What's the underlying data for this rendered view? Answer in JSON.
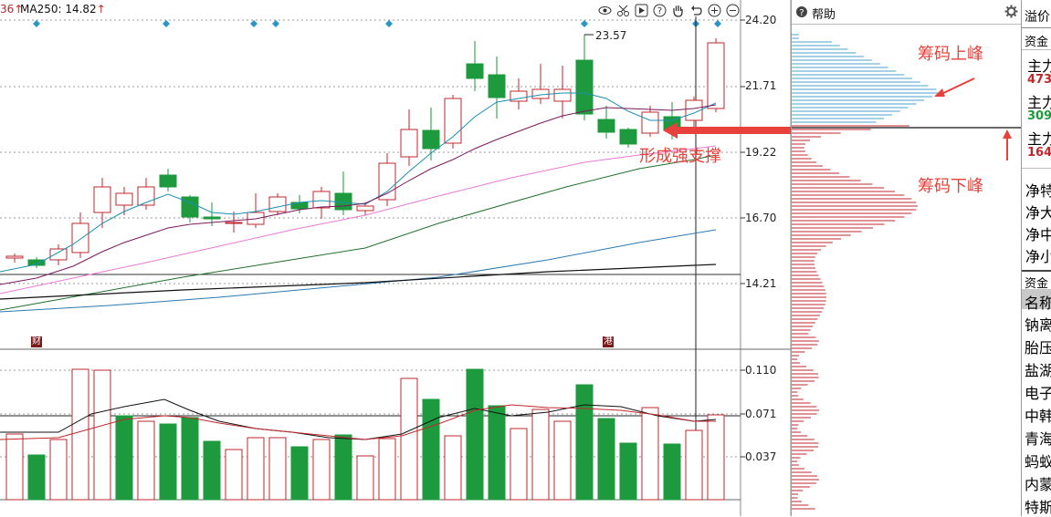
{
  "toolbar": {
    "ma_prefix": "36",
    "ma250_label": "MA250: 14.82",
    "up_arrow": "↑",
    "icons": [
      "eye-icon",
      "scissors-icon",
      "play-icon",
      "help-icon",
      "hand-icon",
      "undo-icon",
      "zoom-in-icon",
      "zoom-out-icon"
    ]
  },
  "price_axis": {
    "ticks": [
      "24.20",
      "21.71",
      "19.22",
      "16.70",
      "14.21"
    ],
    "high_marker": "23.57"
  },
  "volume_axis": {
    "ticks": [
      "0.110",
      "0.071",
      "0.037"
    ]
  },
  "event_tags": [
    "财",
    "港"
  ],
  "annotations": {
    "strong_support": "形成强支撑",
    "chip_up_peak": "筹码上峰",
    "chip_down_peak": "筹码下峰"
  },
  "colors": {
    "up": "#c0272d",
    "down": "#1e9a3e",
    "annotation": "#e8403a",
    "ma_short": "#1a8fb0",
    "ma_mid": "#7b1a5e",
    "ma_pink": "#e87ad6",
    "ma_green": "#1f6f2a",
    "ma_blue": "#2a7ab0",
    "ma_black": "#111111",
    "chip_upper": "#4aa3c8",
    "chip_lower": "#c0272d"
  },
  "help_panel": {
    "title": "帮助"
  },
  "right_panel": {
    "top_label": "溢价",
    "fund_header": "资金",
    "rows": [
      {
        "text": "主力",
        "color": "#000000"
      },
      {
        "text": "473",
        "color": "#c0272d"
      },
      {
        "text": "主力",
        "color": "#000000"
      },
      {
        "text": "309",
        "color": "#1e9a3e"
      },
      {
        "text": "主力",
        "color": "#000000"
      },
      {
        "text": "164",
        "color": "#c0272d"
      }
    ],
    "net_rows": [
      "净特",
      "净大",
      "净中",
      "净小"
    ],
    "list_header": "资金",
    "list": [
      "名称",
      "钠离",
      "胎压",
      "盐湖",
      "电子",
      "中韩",
      "青海",
      "蚂蚁",
      "内蒙",
      "特斯"
    ]
  }
}
